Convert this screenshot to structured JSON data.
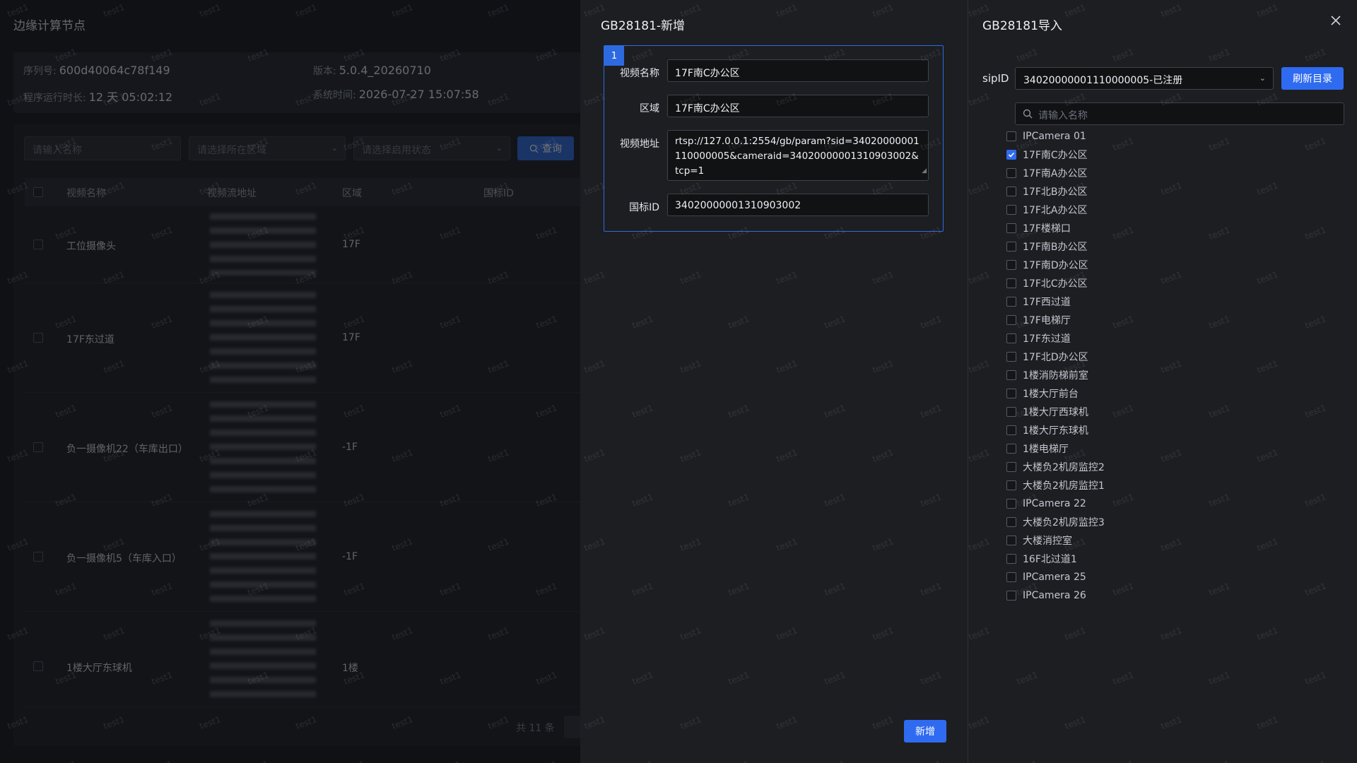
{
  "left_page": {
    "title": "边缘计算节点",
    "info": {
      "serial_label": "序列号:",
      "serial": "600d40064c78f149",
      "version_label": "版本:",
      "version": "5.0.4_20260710",
      "uptime_label": "程序运行时长:",
      "uptime": "12 天 05:02:12",
      "systime_label": "系统时间:",
      "systime": "2026-07-27 15:07:58"
    },
    "filters": {
      "name_placeholder": "请输入名称",
      "area_placeholder": "请选择所在区域",
      "status_placeholder": "请选择启用状态",
      "query_label": "查询"
    },
    "table": {
      "headers": [
        "视频名称",
        "视频流地址",
        "区域",
        "国标ID"
      ],
      "rows": [
        {
          "name": "工位摄像头",
          "area": "17F"
        },
        {
          "name": "17F东过道",
          "area": "17F"
        },
        {
          "name": "负一摄像机22（车库出口）",
          "area": "-1F"
        },
        {
          "name": "负一摄像机5（车库入口）",
          "area": "-1F"
        },
        {
          "name": "1楼大厅东球机",
          "area": "1楼"
        }
      ]
    },
    "pager_total": "共 11 条"
  },
  "add_dialog": {
    "title": "GB28181-新增",
    "badge": "1",
    "fields": {
      "name_label": "视频名称",
      "name_value": "17F南C办公区",
      "area_label": "区域",
      "area_value": "17F南C办公区",
      "url_label": "视频地址",
      "url_value": "rtsp://127.0.0.1:2554/gb/param?sid=34020000001110000005&cameraid=34020000001310903002&tcp=1",
      "gbid_label": "国标ID",
      "gbid_value": "34020000001310903002"
    },
    "submit_label": "新增"
  },
  "import_dialog": {
    "title": "GB28181导入",
    "sip_label": "sipID",
    "sip_value": "34020000001110000005-已注册",
    "refresh_label": "刷新目录",
    "search_placeholder": "请输入名称",
    "accent": "#2f6bf0",
    "items": [
      {
        "label": "IPCamera 01",
        "checked": false
      },
      {
        "label": "17F南C办公区",
        "checked": true
      },
      {
        "label": "17F南A办公区",
        "checked": false
      },
      {
        "label": "17F北B办公区",
        "checked": false
      },
      {
        "label": "17F北A办公区",
        "checked": false
      },
      {
        "label": "17F楼梯口",
        "checked": false
      },
      {
        "label": "17F南B办公区",
        "checked": false
      },
      {
        "label": "17F南D办公区",
        "checked": false
      },
      {
        "label": "17F北C办公区",
        "checked": false
      },
      {
        "label": "17F西过道",
        "checked": false
      },
      {
        "label": "17F电梯厅",
        "checked": false
      },
      {
        "label": "17F东过道",
        "checked": false
      },
      {
        "label": "17F北D办公区",
        "checked": false
      },
      {
        "label": "1楼消防梯前室",
        "checked": false
      },
      {
        "label": "1楼大厅前台",
        "checked": false
      },
      {
        "label": "1楼大厅西球机",
        "checked": false
      },
      {
        "label": "1楼大厅东球机",
        "checked": false
      },
      {
        "label": "1楼电梯厅",
        "checked": false
      },
      {
        "label": "大楼负2机房监控2",
        "checked": false
      },
      {
        "label": "大楼负2机房监控1",
        "checked": false
      },
      {
        "label": "IPCamera 22",
        "checked": false
      },
      {
        "label": "大楼负2机房监控3",
        "checked": false
      },
      {
        "label": "大楼消控室",
        "checked": false
      },
      {
        "label": "16F北过道1",
        "checked": false
      },
      {
        "label": "IPCamera 25",
        "checked": false
      },
      {
        "label": "IPCamera 26",
        "checked": false
      }
    ]
  },
  "watermark": "test1"
}
